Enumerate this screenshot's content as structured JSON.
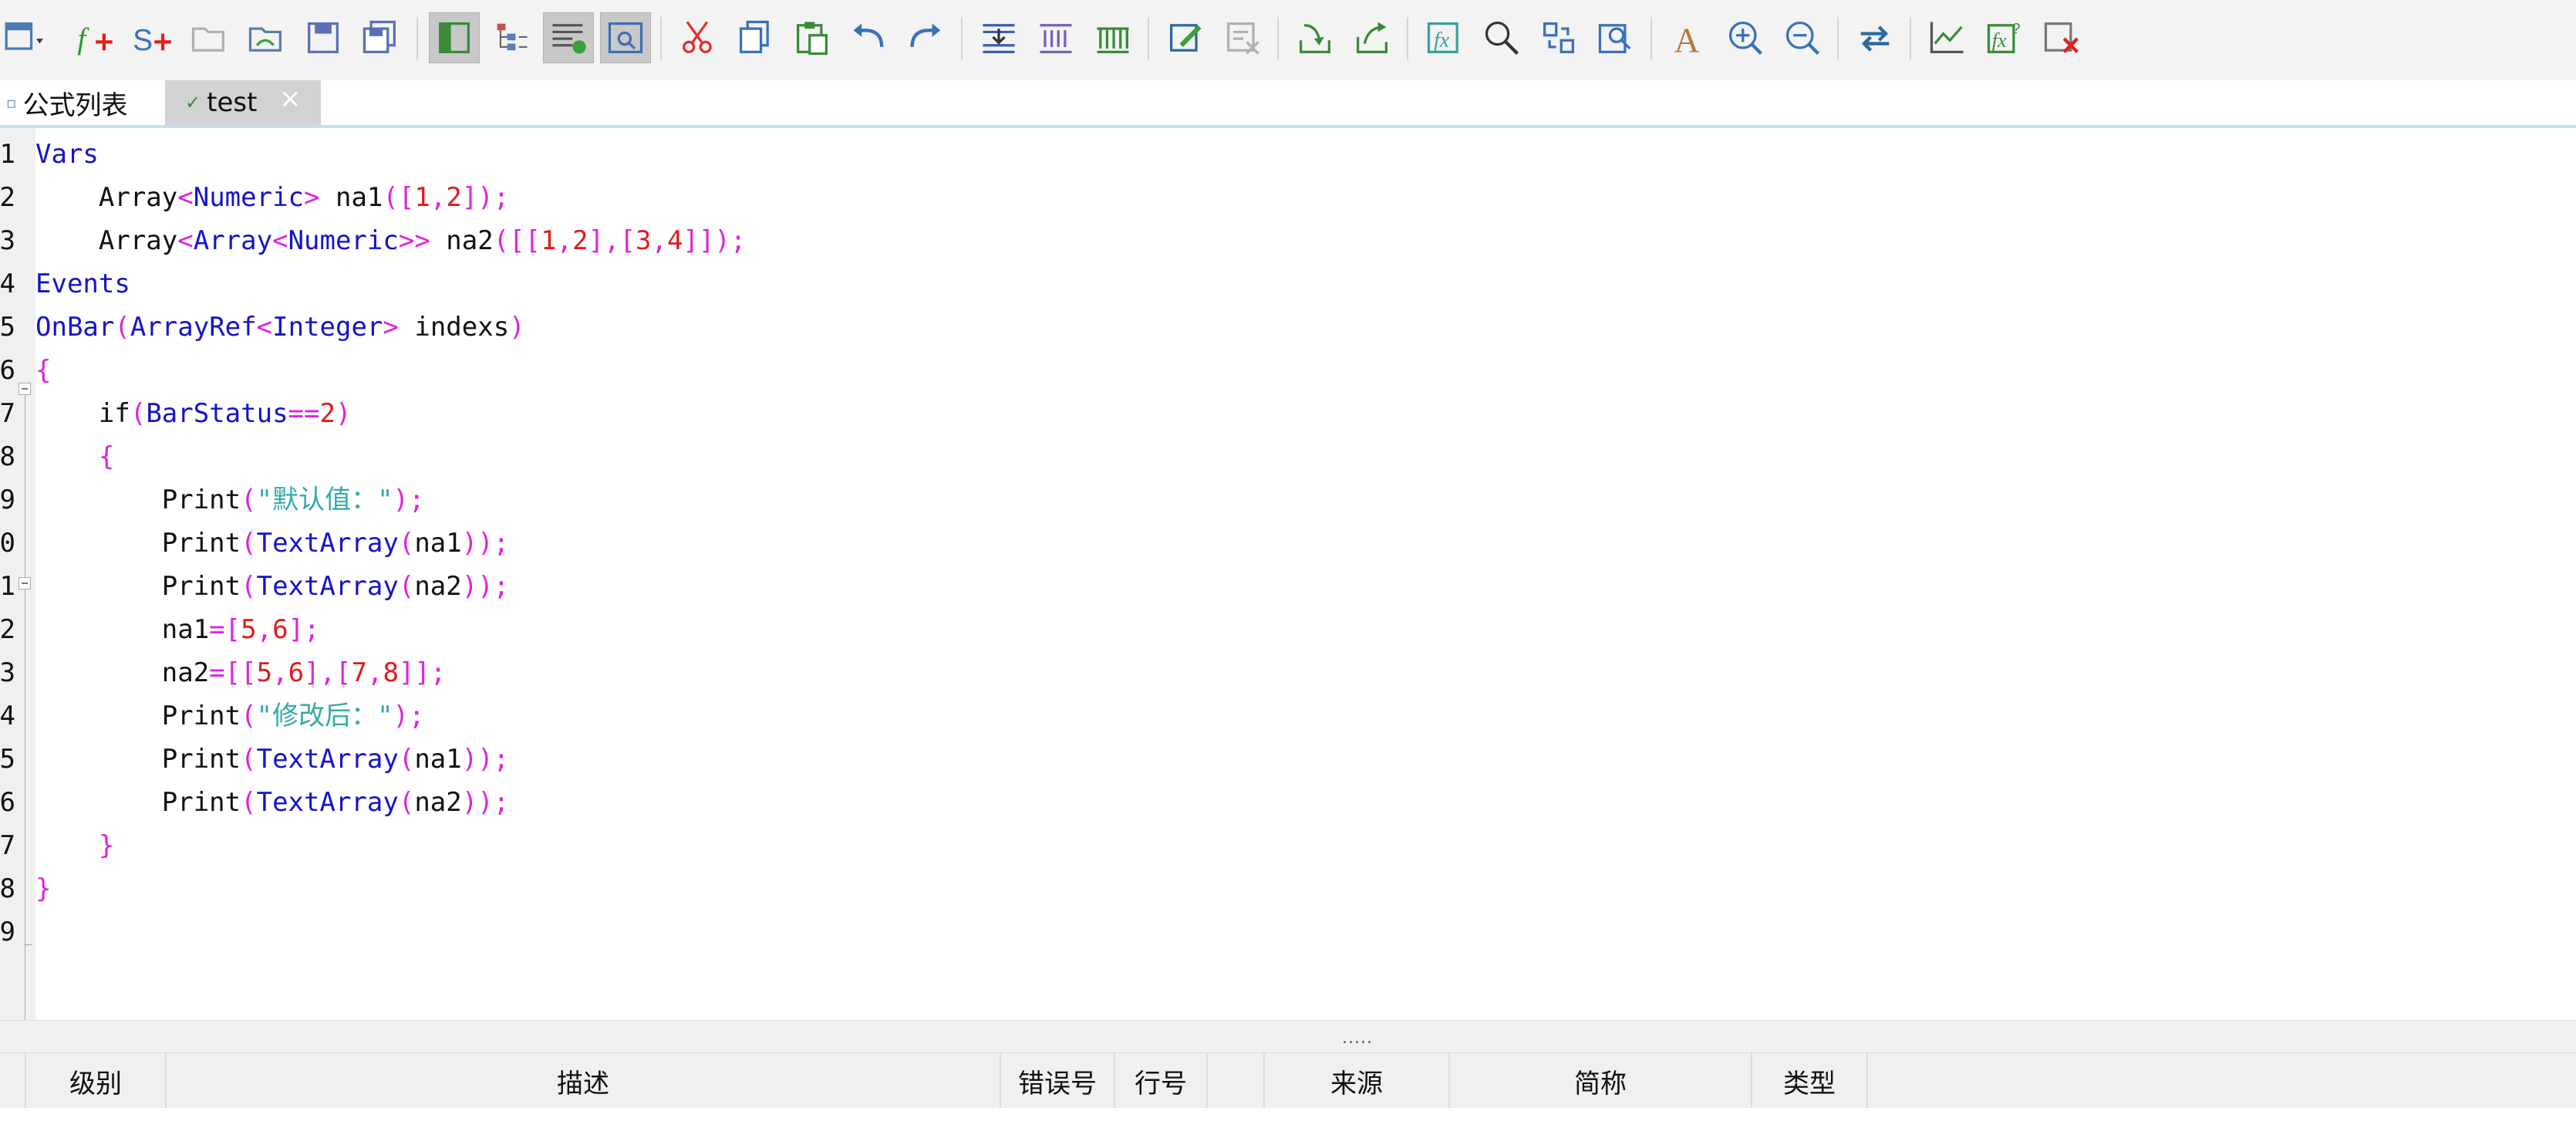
{
  "toolbar": {
    "buttons": [
      {
        "icon": "format-dropdown-icon"
      },
      {
        "icon": "new-formula-icon"
      },
      {
        "icon": "new-strategy-icon"
      },
      {
        "icon": "open-folder-icon"
      },
      {
        "icon": "open-view-icon"
      },
      {
        "icon": "save-icon"
      },
      {
        "icon": "save-all-icon"
      },
      {
        "icon": "toggle-panel-icon",
        "active": true
      },
      {
        "icon": "tree-view-icon"
      },
      {
        "icon": "output-view-icon",
        "active": true
      },
      {
        "icon": "preview-icon",
        "active": true
      },
      {
        "icon": "cut-icon"
      },
      {
        "icon": "copy-icon"
      },
      {
        "icon": "paste-icon"
      },
      {
        "icon": "undo-icon"
      },
      {
        "icon": "redo-icon"
      },
      {
        "icon": "compile-icon"
      },
      {
        "icon": "compile-all-icon"
      },
      {
        "icon": "compile-grid-icon"
      },
      {
        "icon": "edit-icon"
      },
      {
        "icon": "clear-icon"
      },
      {
        "icon": "import-icon"
      },
      {
        "icon": "export-icon"
      },
      {
        "icon": "function-icon"
      },
      {
        "icon": "search-icon"
      },
      {
        "icon": "replace-icon"
      },
      {
        "icon": "find-in-files-icon"
      },
      {
        "icon": "font-icon"
      },
      {
        "icon": "zoom-in-icon"
      },
      {
        "icon": "zoom-out-icon"
      },
      {
        "icon": "refresh-icon"
      },
      {
        "icon": "chart-icon"
      },
      {
        "icon": "function-help-icon"
      },
      {
        "icon": "close-window-icon"
      }
    ]
  },
  "tabs": [
    {
      "label": "公式列表"
    },
    {
      "label": "test",
      "close": "×"
    }
  ],
  "editor": {
    "line_numbers": [
      "1",
      "2",
      "3",
      "4",
      "5",
      "6",
      "7",
      "8",
      "9",
      "0",
      "1",
      "2",
      "3",
      "4",
      "5",
      "6",
      "7",
      "8",
      "9"
    ],
    "lines": [
      [
        [
          "k",
          "Vars"
        ]
      ],
      [
        [
          "i",
          "    Array"
        ],
        [
          "p",
          "<"
        ],
        [
          "k",
          "Numeric"
        ],
        [
          "p",
          ">"
        ],
        [
          "i",
          " na1"
        ],
        [
          "p",
          "(["
        ],
        [
          "n",
          "1"
        ],
        [
          "p",
          ","
        ],
        [
          "n",
          "2"
        ],
        [
          "p",
          "]);"
        ]
      ],
      [
        [
          "i",
          "    Array"
        ],
        [
          "p",
          "<"
        ],
        [
          "k",
          "Array"
        ],
        [
          "p",
          "<"
        ],
        [
          "k",
          "Numeric"
        ],
        [
          "p",
          ">>"
        ],
        [
          "i",
          " na2"
        ],
        [
          "p",
          "([["
        ],
        [
          "n",
          "1"
        ],
        [
          "p",
          ","
        ],
        [
          "n",
          "2"
        ],
        [
          "p",
          "],["
        ],
        [
          "n",
          "3"
        ],
        [
          "p",
          ","
        ],
        [
          "n",
          "4"
        ],
        [
          "p",
          "]]);"
        ]
      ],
      [
        [
          "k",
          "Events"
        ]
      ],
      [
        [
          "k",
          "OnBar"
        ],
        [
          "p",
          "("
        ],
        [
          "k",
          "ArrayRef"
        ],
        [
          "p",
          "<"
        ],
        [
          "k",
          "Integer"
        ],
        [
          "p",
          ">"
        ],
        [
          "i",
          " indexs"
        ],
        [
          "p",
          ")"
        ]
      ],
      [
        [
          "p",
          "{"
        ]
      ],
      [
        [
          "i",
          "    if"
        ],
        [
          "p",
          "("
        ],
        [
          "k",
          "BarStatus"
        ],
        [
          "p",
          "=="
        ],
        [
          "n",
          "2"
        ],
        [
          "p",
          ")"
        ]
      ],
      [
        [
          "p",
          "    {"
        ]
      ],
      [
        [
          "i",
          "        Print"
        ],
        [
          "p",
          "("
        ],
        [
          "s",
          "\"默认值：\""
        ],
        [
          "p",
          ");"
        ]
      ],
      [
        [
          "i",
          "        Print"
        ],
        [
          "p",
          "("
        ],
        [
          "k",
          "TextArray"
        ],
        [
          "p",
          "("
        ],
        [
          "i",
          "na1"
        ],
        [
          "p",
          "));"
        ]
      ],
      [
        [
          "i",
          "        Print"
        ],
        [
          "p",
          "("
        ],
        [
          "k",
          "TextArray"
        ],
        [
          "p",
          "("
        ],
        [
          "i",
          "na2"
        ],
        [
          "p",
          "));"
        ]
      ],
      [
        [
          "i",
          "        na1"
        ],
        [
          "p",
          "=["
        ],
        [
          "n",
          "5"
        ],
        [
          "p",
          ","
        ],
        [
          "n",
          "6"
        ],
        [
          "p",
          "];"
        ]
      ],
      [
        [
          "i",
          "        na2"
        ],
        [
          "p",
          "=[["
        ],
        [
          "n",
          "5"
        ],
        [
          "p",
          ","
        ],
        [
          "n",
          "6"
        ],
        [
          "p",
          "],["
        ],
        [
          "n",
          "7"
        ],
        [
          "p",
          ","
        ],
        [
          "n",
          "8"
        ],
        [
          "p",
          "]];"
        ]
      ],
      [
        [
          "i",
          "        Print"
        ],
        [
          "p",
          "("
        ],
        [
          "s",
          "\"修改后：\""
        ],
        [
          "p",
          ");"
        ]
      ],
      [
        [
          "i",
          "        Print"
        ],
        [
          "p",
          "("
        ],
        [
          "k",
          "TextArray"
        ],
        [
          "p",
          "("
        ],
        [
          "i",
          "na1"
        ],
        [
          "p",
          "));"
        ]
      ],
      [
        [
          "i",
          "        Print"
        ],
        [
          "p",
          "("
        ],
        [
          "k",
          "TextArray"
        ],
        [
          "p",
          "("
        ],
        [
          "i",
          "na2"
        ],
        [
          "p",
          "));"
        ]
      ],
      [
        [
          "p",
          "    }"
        ]
      ],
      [
        [
          "p",
          "}"
        ]
      ],
      []
    ]
  },
  "splitter": {
    "grip": "....."
  },
  "output_columns": [
    {
      "label": ""
    },
    {
      "label": "级别"
    },
    {
      "label": "描述"
    },
    {
      "label": "错误号"
    },
    {
      "label": "行号"
    },
    {
      "label": ""
    },
    {
      "label": "来源"
    },
    {
      "label": "简称"
    },
    {
      "label": "类型"
    }
  ]
}
